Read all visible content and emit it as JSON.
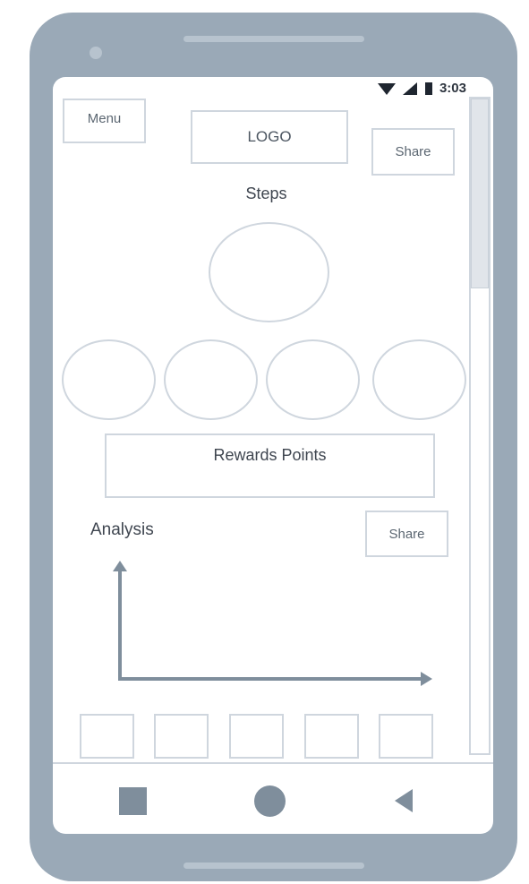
{
  "status_bar": {
    "time": "3:03",
    "icons": [
      "wifi-icon",
      "signal-icon",
      "battery-icon"
    ]
  },
  "header": {
    "menu_label": "Menu",
    "logo_text": "LOGO",
    "share_label": "Share"
  },
  "steps": {
    "title": "Steps"
  },
  "rewards": {
    "label": "Rewards Points"
  },
  "analysis": {
    "title": "Analysis",
    "share_label": "Share"
  },
  "bottom_nav": {
    "icons": [
      "square-icon",
      "circle-icon",
      "back-triangle-icon"
    ]
  },
  "colors": {
    "frame": "#9aa9b7",
    "outline": "#cfd6de",
    "axis": "#7f8e9c",
    "nav_icon": "#7f8e9c"
  }
}
